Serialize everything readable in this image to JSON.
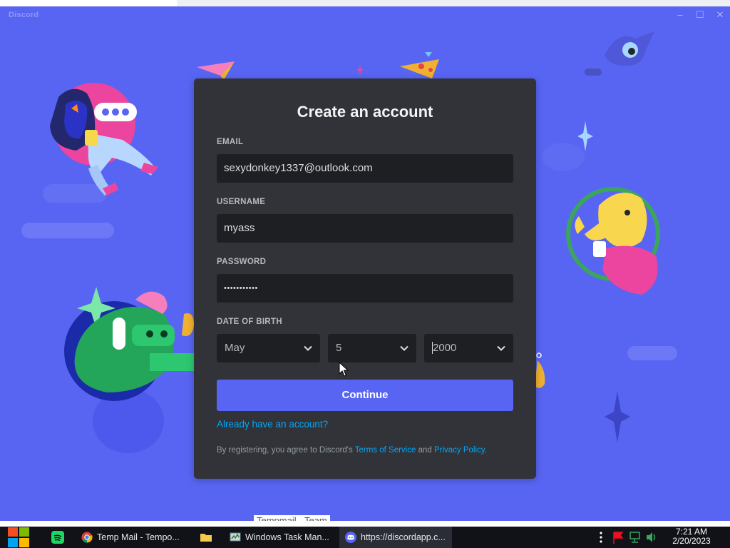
{
  "window": {
    "app_name": "Discord",
    "controls": {
      "minimize": "–",
      "maximize": "☐",
      "close": "✕"
    }
  },
  "form": {
    "title": "Create an account",
    "email": {
      "label": "EMAIL",
      "value": "sexydonkey1337@outlook.com"
    },
    "username": {
      "label": "USERNAME",
      "value": "myass"
    },
    "password": {
      "label": "PASSWORD",
      "value": "•••••••••••"
    },
    "dob": {
      "label": "DATE OF BIRTH",
      "month": "May",
      "day": "5",
      "year": "2000"
    },
    "continue_label": "Continue",
    "login_link": "Already have an account?",
    "terms": {
      "prefix": "By registering, you agree to Discord's ",
      "tos": "Terms of Service",
      "and": " and ",
      "privacy": "Privacy Policy",
      "suffix": "."
    }
  },
  "behind_window_text": "Tempmail - Team",
  "taskbar": {
    "tasks": [
      {
        "label": "Temp Mail - Tempo...",
        "icon": "chrome-icon"
      },
      {
        "label": "Windows Task Man...",
        "icon": "task-manager-icon"
      },
      {
        "label": "https://discordapp.c...",
        "icon": "discord-icon"
      }
    ],
    "clock": {
      "time": "7:21 AM",
      "date": "2/20/2023"
    }
  },
  "colors": {
    "brand": "#5865f2",
    "card": "#313338",
    "input": "#1e1f22",
    "link": "#00a8fc"
  }
}
